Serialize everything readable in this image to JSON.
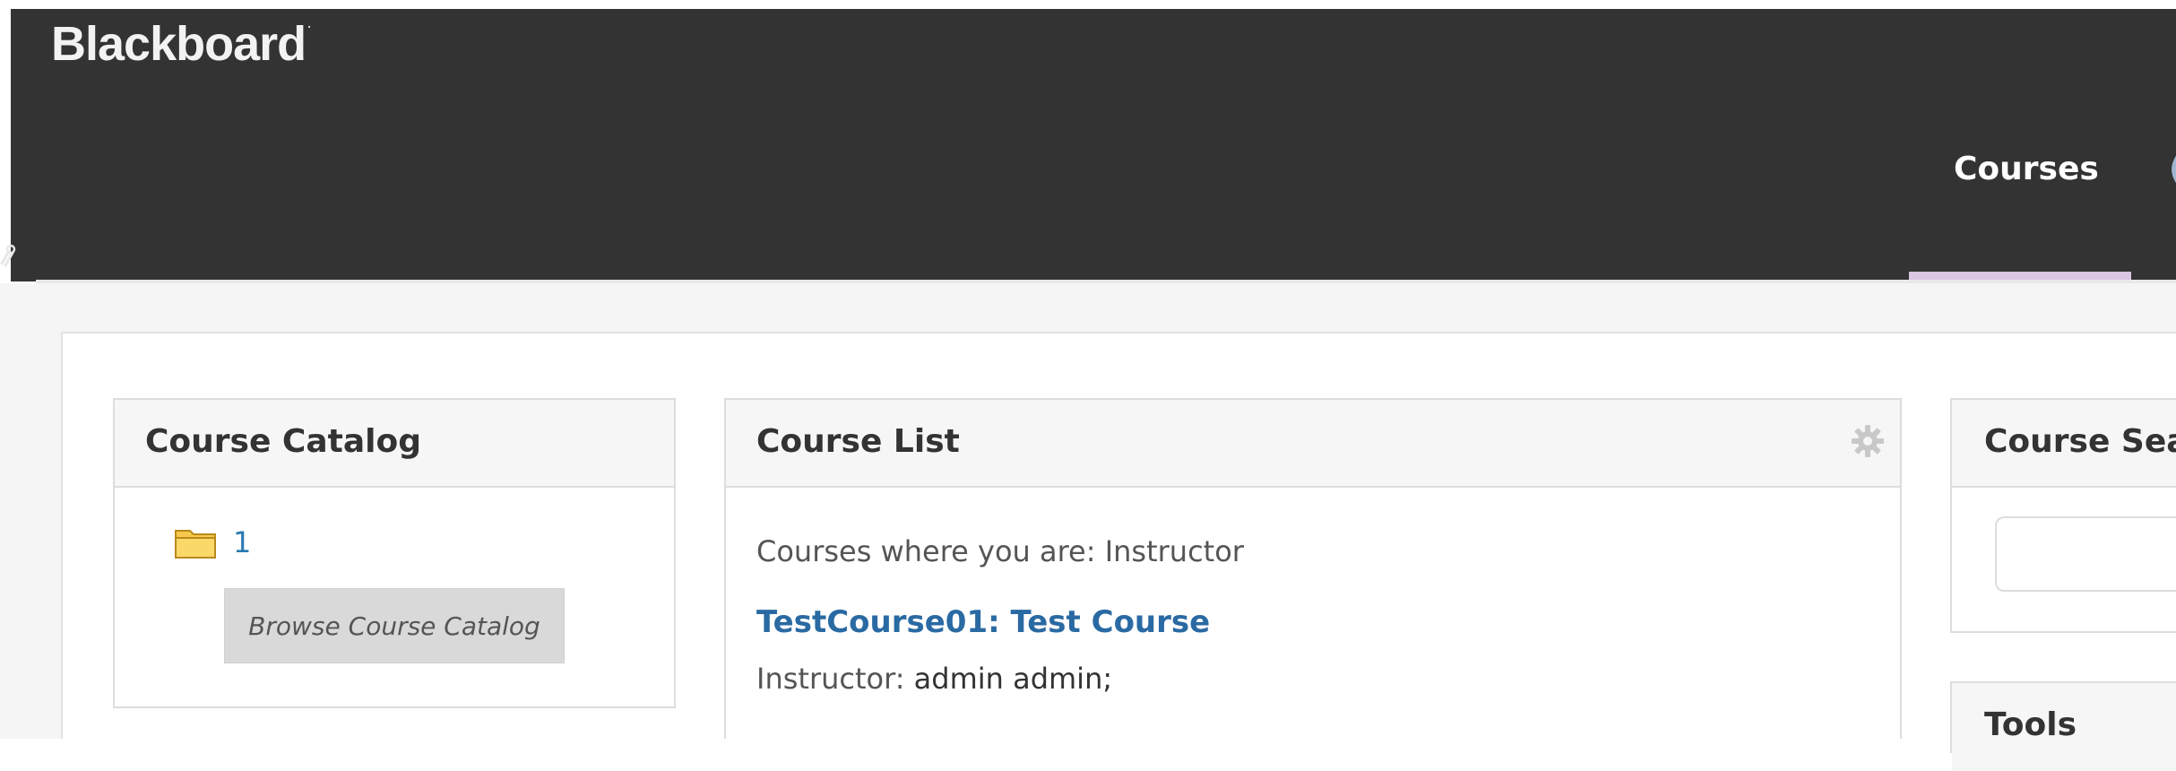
{
  "header": {
    "brand": "Blackboard",
    "brand_mark": ".",
    "nav_tabs": [
      {
        "label": "Courses",
        "active": true
      }
    ],
    "next_tab_fragment": "("
  },
  "course_catalog": {
    "title": "Course Catalog",
    "folder_link": "1",
    "browse_button": "Browse Course Catalog"
  },
  "course_list": {
    "title": "Course List",
    "role_line": "Courses where you are: Instructor",
    "courses": [
      {
        "name": "TestCourse01: Test Course",
        "instructor_label": "Instructor:",
        "instructor_name": " admin admin;"
      }
    ]
  },
  "course_search": {
    "title": "Course Search"
  },
  "tools": {
    "title": "Tools"
  },
  "colors": {
    "header_bg": "#333333",
    "active_tab_underline": "#d9c7e3",
    "link": "#2a7ab0",
    "module_header_bg": "#f6f6f6",
    "content_bg": "#f5f5f5"
  },
  "icons": [
    "folder-icon",
    "gear-icon",
    "link-icon"
  ]
}
